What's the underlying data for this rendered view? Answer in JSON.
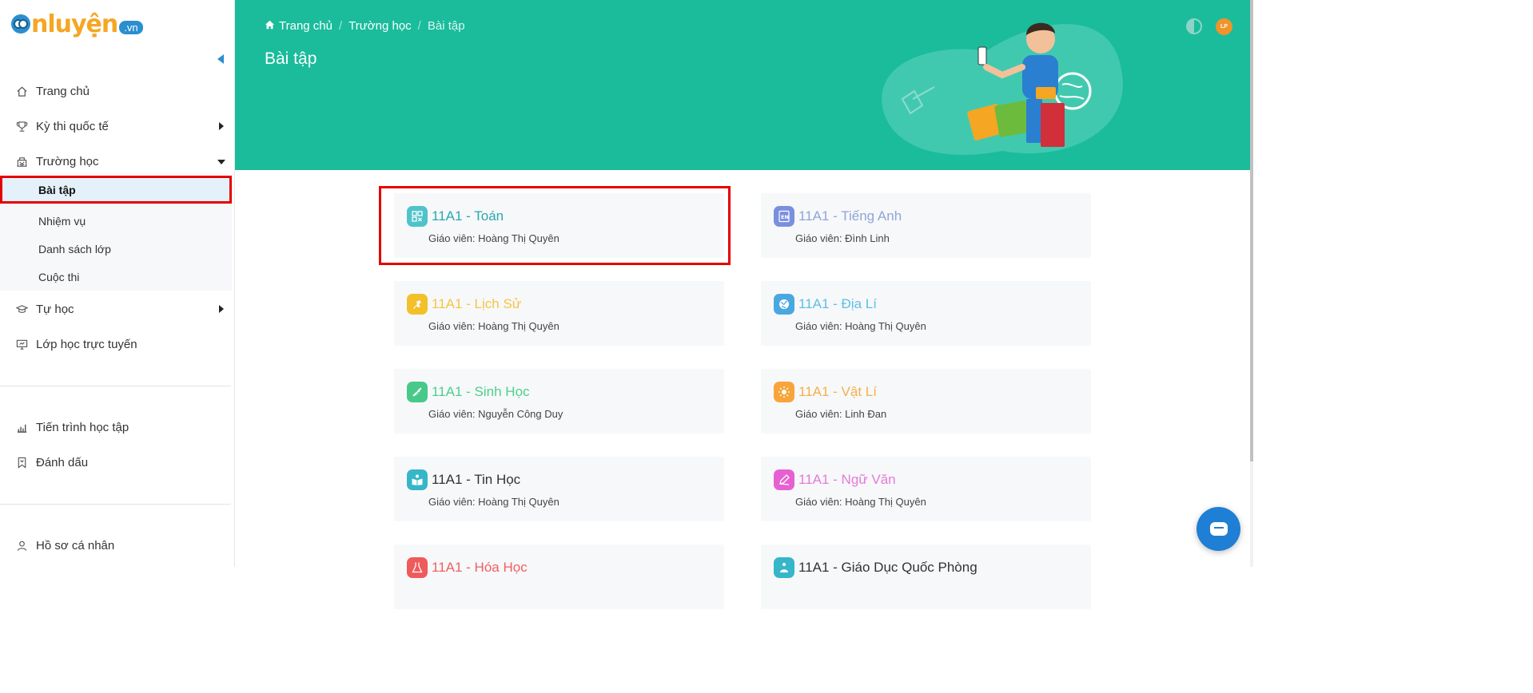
{
  "logo": {
    "text": "nluyện",
    "suffix": ".vn"
  },
  "sidebar": {
    "items": [
      {
        "label": "Trang chủ",
        "icon": "home-icon"
      },
      {
        "label": "Kỳ thi quốc tế",
        "icon": "trophy-icon"
      },
      {
        "label": "Trường học",
        "icon": "school-icon"
      },
      {
        "label": "Tự học",
        "icon": "graduation-cap-icon"
      },
      {
        "label": "Lớp học trực tuyến",
        "icon": "monitor-icon"
      },
      {
        "label": "Tiến trình học tập",
        "icon": "bar-chart-icon"
      },
      {
        "label": "Đánh dấu",
        "icon": "bookmark-icon"
      },
      {
        "label": "Hồ sơ cá nhân",
        "icon": "user-icon"
      }
    ],
    "submenu": [
      {
        "label": "Bài tập",
        "active": true
      },
      {
        "label": "Nhiệm vụ"
      },
      {
        "label": "Danh sách lớp"
      },
      {
        "label": "Cuộc thi"
      }
    ]
  },
  "header": {
    "breadcrumb": [
      "Trang chủ",
      "Trường học",
      "Bài tập"
    ],
    "title": "Bài tập",
    "avatar_initials": "LP",
    "bg_color": "#1abc9c"
  },
  "cards": [
    {
      "title": "11A1 - Toán",
      "teacher": "Giáo viên: Hoàng Thị Quyên",
      "color": "#2aa7b0",
      "icon_bg": "#4fc3c9",
      "icon": "calculator-icon"
    },
    {
      "title": "11A1 - Tiếng Anh",
      "teacher": "Giáo viên: Đình Linh",
      "color": "#8ea6d8",
      "icon_bg": "#7b8fe0",
      "icon": "english-icon"
    },
    {
      "title": "11A1 - Lịch Sử",
      "teacher": "Giáo viên: Hoàng Thị Quyên",
      "color": "#f5c542",
      "icon_bg": "#f2c029",
      "icon": "history-icon"
    },
    {
      "title": "11A1 - Địa Lí",
      "teacher": "Giáo viên: Hoàng Thị Quyên",
      "color": "#5bc0e6",
      "icon_bg": "#4aa8e0",
      "icon": "globe-icon"
    },
    {
      "title": "11A1 - Sinh Học",
      "teacher": "Giáo viên: Nguyễn Công Duy",
      "color": "#4cd08a",
      "icon_bg": "#47c98a",
      "icon": "dna-icon"
    },
    {
      "title": "11A1 - Vật Lí",
      "teacher": "Giáo viên: Linh Đan",
      "color": "#f5b04a",
      "icon_bg": "#f7a53a",
      "icon": "atom-icon"
    },
    {
      "title": "11A1 - Tin Học",
      "teacher": "Giáo viên: Hoàng Thị Quyên",
      "color": "#333333",
      "icon_bg": "#36b6c9",
      "icon": "book-person-icon"
    },
    {
      "title": "11A1 - Ngữ Văn",
      "teacher": "Giáo viên: Hoàng Thị Quyên",
      "color": "#e57ad8",
      "icon_bg": "#e760d3",
      "icon": "pen-icon"
    },
    {
      "title": "11A1 - Hóa Học",
      "teacher": "",
      "color": "#f06060",
      "icon_bg": "#ef5a5a",
      "icon": "flask-icon"
    },
    {
      "title": "11A1 - Giáo Dục Quốc Phòng",
      "teacher": "",
      "color": "#333333",
      "icon_bg": "#36b6c9",
      "icon": "shield-icon"
    }
  ]
}
